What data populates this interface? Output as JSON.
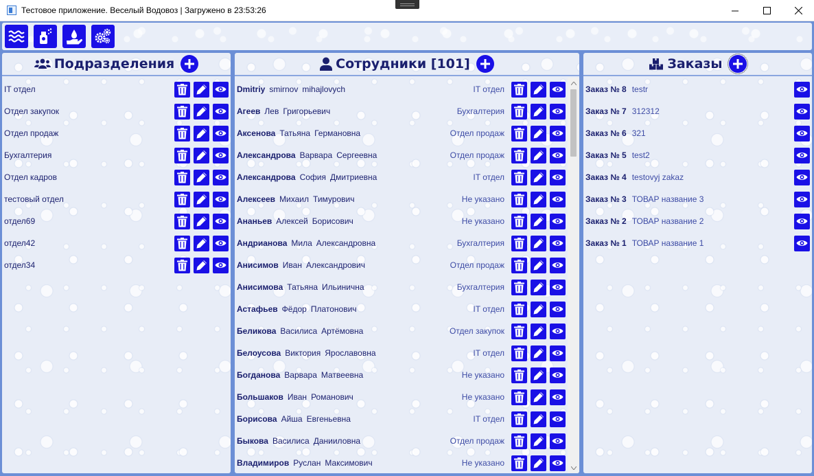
{
  "window": {
    "title": "Тестовое приложение. Веселый Водовоз | Загружено в 23:53:26"
  },
  "toolbar": {
    "buttons": [
      "water-waves-icon",
      "spray-bottle-icon",
      "hand-drop-icon",
      "gears-icon"
    ]
  },
  "departments": {
    "title": "Подразделения",
    "items": [
      "IT отдел",
      "Отдел закупок",
      "Отдел продаж",
      "Бухгалтерия",
      "Отдел кадров",
      "тестовый отдел",
      "отдел69",
      "отдел42",
      "отдел34"
    ]
  },
  "employees": {
    "title": "Сотрудники [101]",
    "items": [
      {
        "last": "Dmitriy",
        "first": "smirnov",
        "middle": "mihajlovych",
        "dept": "IT отдел"
      },
      {
        "last": "Агеев",
        "first": "Лев",
        "middle": "Григорьевич",
        "dept": "Бухгалтерия"
      },
      {
        "last": "Аксенова",
        "first": "Татьяна",
        "middle": "Германовна",
        "dept": "Отдел продаж"
      },
      {
        "last": "Александрова",
        "first": "Варвара",
        "middle": "Сергеевна",
        "dept": "Отдел продаж"
      },
      {
        "last": "Александрова",
        "first": "София",
        "middle": "Дмитриевна",
        "dept": "IT отдел"
      },
      {
        "last": "Алексеев",
        "first": "Михаил",
        "middle": "Тимурович",
        "dept": "Не указано"
      },
      {
        "last": "Ананьев",
        "first": "Алексей",
        "middle": "Борисович",
        "dept": "Не указано"
      },
      {
        "last": "Андрианова",
        "first": "Мила",
        "middle": "Александровна",
        "dept": "Бухгалтерия"
      },
      {
        "last": "Анисимов",
        "first": "Иван",
        "middle": "Александрович",
        "dept": "Отдел продаж"
      },
      {
        "last": "Анисимова",
        "first": "Татьяна",
        "middle": "Ильинична",
        "dept": "Бухгалтерия"
      },
      {
        "last": "Астафьев",
        "first": "Фёдор",
        "middle": "Платонович",
        "dept": "IT отдел"
      },
      {
        "last": "Беликова",
        "first": "Василиса",
        "middle": "Артёмовна",
        "dept": "Отдел закупок"
      },
      {
        "last": "Белоусова",
        "first": "Виктория",
        "middle": "Ярославовна",
        "dept": "IT отдел"
      },
      {
        "last": "Богданова",
        "first": "Варвара",
        "middle": "Матвеевна",
        "dept": "Не указано"
      },
      {
        "last": "Большаков",
        "first": "Иван",
        "middle": "Романович",
        "dept": "Не указано"
      },
      {
        "last": "Борисова",
        "first": "Айша",
        "middle": "Евгеньевна",
        "dept": "IT отдел"
      },
      {
        "last": "Быкова",
        "first": "Василиса",
        "middle": "Данииловна",
        "dept": "Отдел продаж"
      },
      {
        "last": "Владимиров",
        "first": "Руслан",
        "middle": "Максимович",
        "dept": "Не указано"
      }
    ]
  },
  "orders": {
    "title": "Заказы",
    "items": [
      {
        "num": "Заказ № 8",
        "name": "testr"
      },
      {
        "num": "Заказ № 7",
        "name": "312312"
      },
      {
        "num": "Заказ № 6",
        "name": "321"
      },
      {
        "num": "Заказ № 5",
        "name": "test2"
      },
      {
        "num": "Заказ № 4",
        "name": "testovyj zakaz"
      },
      {
        "num": "Заказ № 3",
        "name": "ТОВАР название 3"
      },
      {
        "num": "Заказ № 2",
        "name": "ТОВАР название 2"
      },
      {
        "num": "Заказ № 1",
        "name": "ТОВАР название 1"
      }
    ]
  },
  "colors": {
    "accent": "#1a10e6",
    "frame": "#6c8fd6",
    "text": "#1a1f6e"
  }
}
